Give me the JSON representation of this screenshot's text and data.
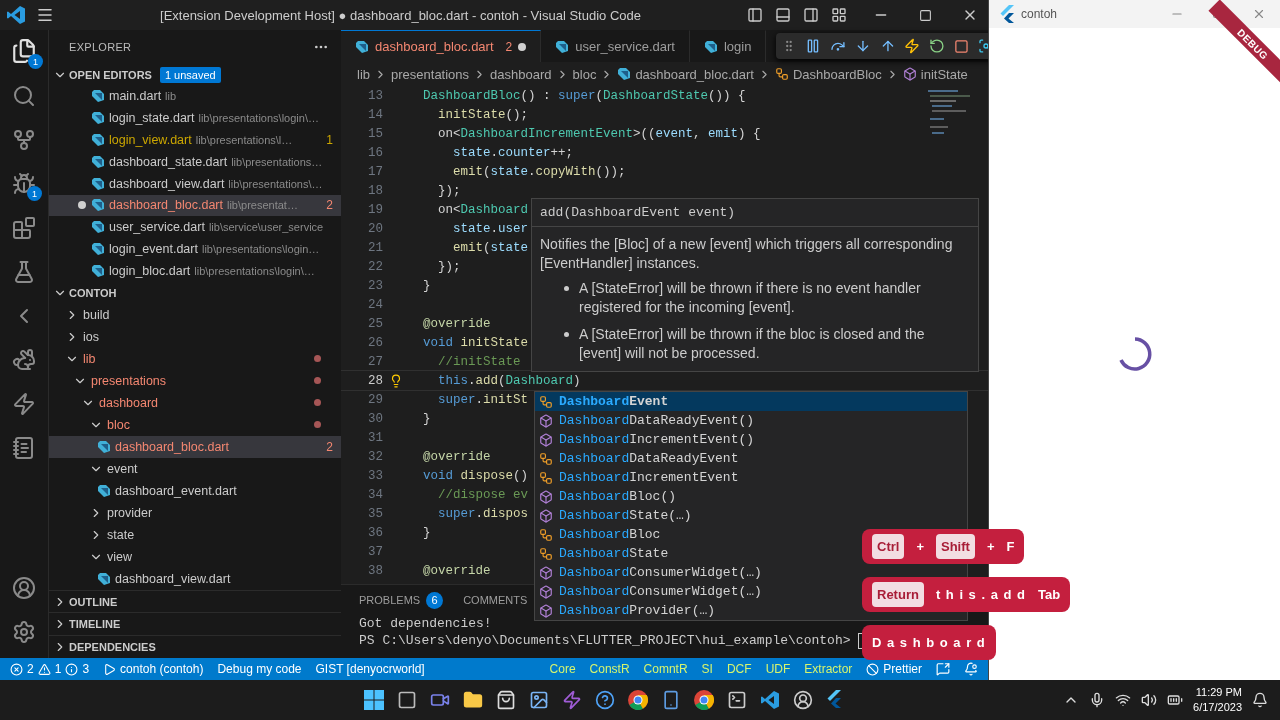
{
  "window": {
    "title": "[Extension Development Host] ● dashboard_bloc.dart - contoh - Visual Studio Code"
  },
  "activity_bar": {
    "explorer_badge": "1",
    "debug_badge": "1"
  },
  "explorer": {
    "title": "EXPLORER",
    "open_editors": {
      "title": "OPEN EDITORS",
      "expanded": true,
      "badge": "1 unsaved",
      "items": [
        {
          "name": "main.dart",
          "path": "lib",
          "kind": "normal",
          "dirty": false,
          "selected": false
        },
        {
          "name": "login_state.dart",
          "path": "lib\\presentations\\login\\…",
          "kind": "normal",
          "dirty": false,
          "selected": false
        },
        {
          "name": "login_view.dart",
          "path": "lib\\presentations\\l…",
          "problems": "1",
          "kind": "warning",
          "dirty": false,
          "selected": false
        },
        {
          "name": "dashboard_state.dart",
          "path": "lib\\presentations…",
          "kind": "normal",
          "dirty": false,
          "selected": false
        },
        {
          "name": "dashboard_view.dart",
          "path": "lib\\presentations\\…",
          "kind": "normal",
          "dirty": false,
          "selected": false
        },
        {
          "name": "dashboard_bloc.dart",
          "path": "lib\\presentat…",
          "problems": "2",
          "kind": "error",
          "dirty": true,
          "selected": true
        },
        {
          "name": "user_service.dart",
          "path": "lib\\service\\user_service",
          "kind": "normal",
          "dirty": false,
          "selected": false
        },
        {
          "name": "login_event.dart",
          "path": "lib\\presentations\\login…",
          "kind": "normal",
          "dirty": false,
          "selected": false
        },
        {
          "name": "login_bloc.dart",
          "path": "lib\\presentations\\login\\…",
          "kind": "normal",
          "dirty": false,
          "selected": false
        }
      ]
    },
    "folder": {
      "title": "CONTOH",
      "expanded": true,
      "tree": [
        {
          "label": "build",
          "kind": "folder",
          "expanded": false,
          "error": false,
          "selected": false
        },
        {
          "label": "ios",
          "kind": "folder",
          "expanded": false,
          "error": false,
          "selected": false
        },
        {
          "label": "lib",
          "kind": "folder",
          "expanded": true,
          "error": true,
          "selected": false,
          "children": [
            {
              "label": "presentations",
              "kind": "folder",
              "expanded": true,
              "error": true,
              "selected": false,
              "children": [
                {
                  "label": "dashboard",
                  "kind": "folder",
                  "expanded": true,
                  "error": true,
                  "selected": false,
                  "children": [
                    {
                      "label": "bloc",
                      "kind": "folder",
                      "expanded": true,
                      "error": true,
                      "selected": false,
                      "children": [
                        {
                          "label": "dashboard_bloc.dart",
                          "kind": "file",
                          "error": true,
                          "problems": "2",
                          "selected": true
                        }
                      ]
                    },
                    {
                      "label": "event",
                      "kind": "folder",
                      "expanded": true,
                      "error": false,
                      "selected": false,
                      "children": [
                        {
                          "label": "dashboard_event.dart",
                          "kind": "file",
                          "error": false,
                          "selected": false
                        }
                      ]
                    },
                    {
                      "label": "provider",
                      "kind": "folder",
                      "expanded": false,
                      "error": false,
                      "selected": false
                    },
                    {
                      "label": "state",
                      "kind": "folder",
                      "expanded": false,
                      "error": false,
                      "selected": false
                    },
                    {
                      "label": "view",
                      "kind": "folder",
                      "expanded": true,
                      "error": false,
                      "selected": false,
                      "children": [
                        {
                          "label": "dashboard_view.dart",
                          "kind": "file",
                          "error": false,
                          "selected": false
                        }
                      ]
                    }
                  ]
                }
              ]
            }
          ]
        }
      ]
    },
    "sections": [
      {
        "title": "OUTLINE",
        "expanded": false
      },
      {
        "title": "TIMELINE",
        "expanded": false
      },
      {
        "title": "DEPENDENCIES",
        "expanded": false
      }
    ]
  },
  "tabs": [
    {
      "label": "dashboard_bloc.dart",
      "problems": "2",
      "dirty": true,
      "selected": true,
      "kind": "error"
    },
    {
      "label": "user_service.dart",
      "dirty": false,
      "selected": false,
      "kind": "normal"
    },
    {
      "label": "login",
      "dirty": false,
      "selected": false,
      "kind": "normal"
    }
  ],
  "breadcrumbs": [
    {
      "label": "lib",
      "kind": "folder"
    },
    {
      "label": "presentations",
      "kind": "folder"
    },
    {
      "label": "dashboard",
      "kind": "folder"
    },
    {
      "label": "bloc",
      "kind": "folder"
    },
    {
      "label": "dashboard_bloc.dart",
      "kind": "file"
    },
    {
      "label": "DashboardBloc",
      "kind": "class"
    },
    {
      "label": "initState",
      "kind": "method"
    }
  ],
  "code": [
    {
      "n": "13",
      "current": false,
      "tokens": [
        {
          "text": "  DashboardBloc",
          "kind": "class"
        },
        {
          "text": "() : ",
          "kind": "plain"
        },
        {
          "text": "super",
          "kind": "keyword"
        },
        {
          "text": "(",
          "kind": "plain"
        },
        {
          "text": "DashboardState",
          "kind": "class"
        },
        {
          "text": "()) {",
          "kind": "plain"
        }
      ]
    },
    {
      "n": "14",
      "current": false,
      "tokens": [
        {
          "text": "    initState",
          "kind": "func"
        },
        {
          "text": "();",
          "kind": "plain"
        }
      ]
    },
    {
      "n": "15",
      "current": false,
      "tokens": [
        {
          "text": "    on<",
          "kind": "plain"
        },
        {
          "text": "DashboardIncrementEvent",
          "kind": "class"
        },
        {
          "text": ">((",
          "kind": "plain"
        },
        {
          "text": "event",
          "kind": "var"
        },
        {
          "text": ", ",
          "kind": "plain"
        },
        {
          "text": "emit",
          "kind": "var"
        },
        {
          "text": ") {",
          "kind": "plain"
        }
      ]
    },
    {
      "n": "16",
      "current": false,
      "tokens": [
        {
          "text": "      state",
          "kind": "var"
        },
        {
          "text": ".",
          "kind": "plain"
        },
        {
          "text": "counter",
          "kind": "var"
        },
        {
          "text": "++;",
          "kind": "plain"
        }
      ]
    },
    {
      "n": "17",
      "current": false,
      "tokens": [
        {
          "text": "      emit",
          "kind": "func"
        },
        {
          "text": "(",
          "kind": "plain"
        },
        {
          "text": "state",
          "kind": "var"
        },
        {
          "text": ".",
          "kind": "plain"
        },
        {
          "text": "copyWith",
          "kind": "func"
        },
        {
          "text": "());",
          "kind": "plain"
        }
      ]
    },
    {
      "n": "18",
      "current": false,
      "tokens": [
        {
          "text": "    });",
          "kind": "plain"
        }
      ]
    },
    {
      "n": "19",
      "current": false,
      "tokens": [
        {
          "text": "    on<",
          "kind": "plain"
        },
        {
          "text": "Dashboard",
          "kind": "class"
        }
      ]
    },
    {
      "n": "20",
      "current": false,
      "tokens": [
        {
          "text": "      state",
          "kind": "var"
        },
        {
          "text": ".",
          "kind": "plain"
        },
        {
          "text": "user",
          "kind": "var"
        }
      ]
    },
    {
      "n": "21",
      "current": false,
      "tokens": [
        {
          "text": "      emit",
          "kind": "func"
        },
        {
          "text": "(",
          "kind": "plain"
        },
        {
          "text": "state",
          "kind": "var"
        }
      ]
    },
    {
      "n": "22",
      "current": false,
      "tokens": [
        {
          "text": "    });",
          "kind": "plain"
        }
      ]
    },
    {
      "n": "23",
      "current": false,
      "tokens": [
        {
          "text": "  }",
          "kind": "plain"
        }
      ]
    },
    {
      "n": "24",
      "current": false
    },
    {
      "n": "25",
      "current": false,
      "tokens": [
        {
          "text": "  @override",
          "kind": "annotation"
        }
      ]
    },
    {
      "n": "26",
      "current": false,
      "tokens": [
        {
          "text": "  void ",
          "kind": "keyword"
        },
        {
          "text": "initState",
          "kind": "func"
        }
      ]
    },
    {
      "n": "27",
      "current": false,
      "tokens": [
        {
          "text": "    //initState",
          "kind": "comment"
        }
      ]
    },
    {
      "n": "28",
      "current": true,
      "tokens": [
        {
          "text": "    this",
          "kind": "keyword"
        },
        {
          "text": ".",
          "kind": "plain"
        },
        {
          "text": "add",
          "kind": "func"
        },
        {
          "text": "(",
          "kind": "plain"
        },
        {
          "text": "Dashboard",
          "kind": "class"
        },
        {
          "text": ")",
          "kind": "plain"
        }
      ]
    },
    {
      "n": "29",
      "current": false,
      "tokens": [
        {
          "text": "    super",
          "kind": "keyword"
        },
        {
          "text": ".",
          "kind": "plain"
        },
        {
          "text": "initSt",
          "kind": "func"
        }
      ]
    },
    {
      "n": "30",
      "current": false,
      "tokens": [
        {
          "text": "  }",
          "kind": "plain"
        }
      ]
    },
    {
      "n": "31",
      "current": false
    },
    {
      "n": "32",
      "current": false,
      "tokens": [
        {
          "text": "  @override",
          "kind": "annotation"
        }
      ]
    },
    {
      "n": "33",
      "current": false,
      "tokens": [
        {
          "text": "  void ",
          "kind": "keyword"
        },
        {
          "text": "dispose",
          "kind": "func"
        },
        {
          "text": "()",
          "kind": "plain"
        }
      ]
    },
    {
      "n": "34",
      "current": false,
      "tokens": [
        {
          "text": "    //dispose ev",
          "kind": "comment"
        }
      ]
    },
    {
      "n": "35",
      "current": false,
      "tokens": [
        {
          "text": "    super",
          "kind": "keyword"
        },
        {
          "text": ".",
          "kind": "plain"
        },
        {
          "text": "dispos",
          "kind": "func"
        }
      ]
    },
    {
      "n": "36",
      "current": false,
      "tokens": [
        {
          "text": "  }",
          "kind": "plain"
        }
      ]
    },
    {
      "n": "37",
      "current": false
    },
    {
      "n": "38",
      "current": false,
      "tokens": [
        {
          "text": "  @override",
          "kind": "annotation"
        }
      ]
    }
  ],
  "hover": {
    "signature": "add(DashboardEvent event)",
    "description": "Notifies the [Bloc] of a new [event] which triggers all corresponding [EventHandler] instances.",
    "bullets": [
      "A [StateError] will be thrown if there is no event handler registered for the incoming [event].",
      "A [StateError] will be thrown if the bloc is closed and the [event] will not be processed."
    ]
  },
  "suggestions": [
    {
      "match": "Dashboard",
      "rest": "Event",
      "kind": "class",
      "selected": true
    },
    {
      "match": "Dashboard",
      "rest": "DataReadyEvent()",
      "kind": "constructor",
      "selected": false
    },
    {
      "match": "Dashboard",
      "rest": "IncrementEvent()",
      "kind": "constructor",
      "selected": false
    },
    {
      "match": "Dashboard",
      "rest": "DataReadyEvent",
      "kind": "class",
      "selected": false
    },
    {
      "match": "Dashboard",
      "rest": "IncrementEvent",
      "kind": "class",
      "selected": false
    },
    {
      "match": "Dashboard",
      "rest": "Bloc()",
      "kind": "constructor",
      "selected": false
    },
    {
      "match": "Dashboard",
      "rest": "State(…)",
      "kind": "constructor",
      "selected": false
    },
    {
      "match": "Dashboard",
      "rest": "Bloc",
      "kind": "class",
      "selected": false
    },
    {
      "match": "Dashboard",
      "rest": "State",
      "kind": "class",
      "selected": false
    },
    {
      "match": "Dashboard",
      "rest": "ConsumerWidget(…)",
      "kind": "constructor",
      "selected": false
    },
    {
      "match": "Dashboard",
      "rest": "ConsumerWidget(…)",
      "kind": "constructor",
      "selected": false
    },
    {
      "match": "Dashboard",
      "rest": "Provider(…)",
      "kind": "constructor",
      "selected": false
    }
  ],
  "panel": {
    "tabs": [
      {
        "label": "PROBLEMS",
        "badge": "6",
        "selected": false
      },
      {
        "label": "COMMENTS",
        "selected": false
      }
    ],
    "terminal": [
      "Got dependencies!",
      "PS C:\\Users\\denyo\\Documents\\FLUTTER_PROJECT\\hui_example\\contoh>"
    ]
  },
  "status_bar": {
    "errors": "2",
    "warnings": "1",
    "infos": "3",
    "left": [
      {
        "kind": "debug",
        "text": "contoh (contoh)"
      },
      {
        "kind": "plain",
        "text": "Debug my code"
      },
      {
        "kind": "plain",
        "text": "GIST [denyocrworld]"
      }
    ],
    "right": [
      {
        "kind": "highlight",
        "text": "Core"
      },
      {
        "kind": "highlight",
        "text": "ConstR"
      },
      {
        "kind": "highlight",
        "text": "ComntR"
      },
      {
        "kind": "highlight",
        "text": "SI"
      },
      {
        "kind": "highlight",
        "text": "DCF"
      },
      {
        "kind": "highlight",
        "text": "UDF"
      },
      {
        "kind": "highlight",
        "text": "Extractor"
      },
      {
        "kind": "prettier",
        "text": "Prettier"
      }
    ]
  },
  "keycast": [
    [
      {
        "kind": "key",
        "text": "Ctrl"
      },
      {
        "kind": "plus",
        "text": "+"
      },
      {
        "kind": "key",
        "text": "Shift"
      },
      {
        "kind": "plus",
        "text": "+"
      },
      {
        "kind": "text",
        "text": "F"
      }
    ],
    [
      {
        "kind": "key",
        "text": "Return"
      },
      {
        "kind": "spaced",
        "text": "t h i s . a d d"
      },
      {
        "kind": "text",
        "text": "Tab"
      }
    ],
    [
      {
        "kind": "spaced",
        "text": "D a s h b o a r d"
      }
    ]
  ],
  "app_window": {
    "title": "contoh",
    "debug_banner": "DEBUG"
  },
  "taskbar": {
    "time": "11:29 PM",
    "date": "6/17/2023"
  }
}
